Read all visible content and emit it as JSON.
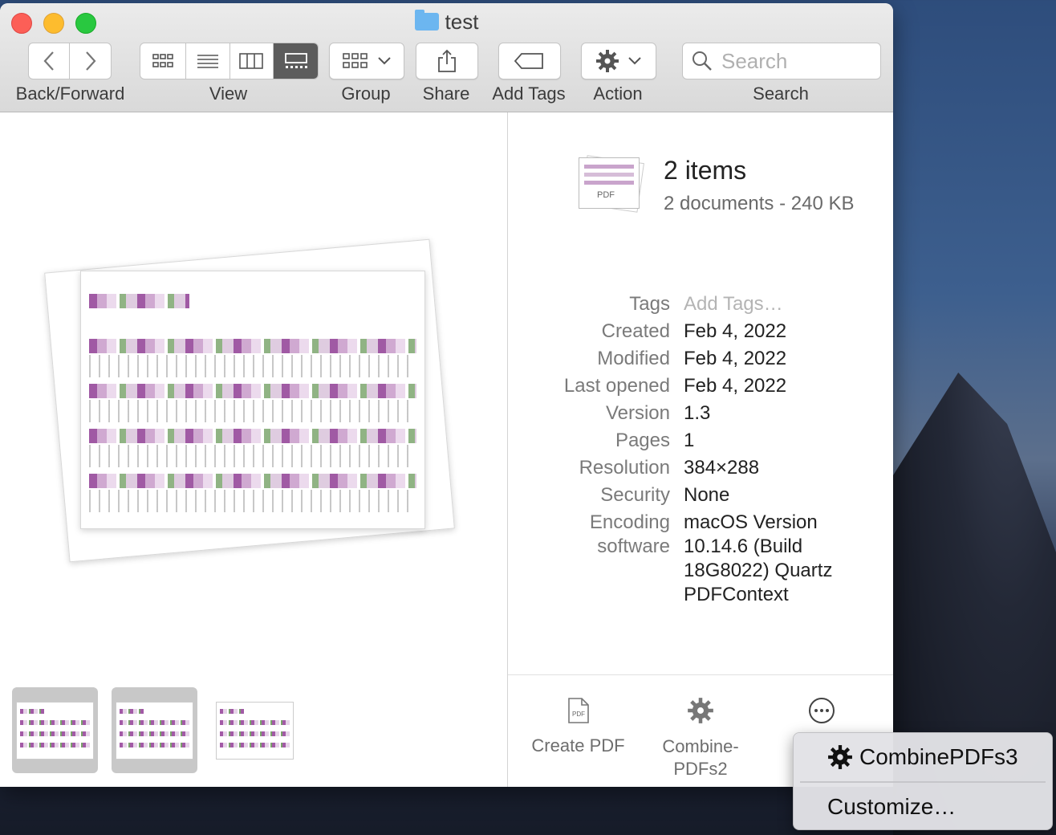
{
  "window": {
    "title": "test"
  },
  "toolbar": {
    "back_forward_label": "Back/Forward",
    "view_label": "View",
    "group_label": "Group",
    "share_label": "Share",
    "add_tags_label": "Add Tags",
    "action_label": "Action",
    "search_label": "Search",
    "search_placeholder": "Search"
  },
  "info": {
    "title": "2 items",
    "subtitle": "2 documents - 240 KB",
    "fields": [
      {
        "key": "Tags",
        "value": "Add Tags…"
      },
      {
        "key": "Created",
        "value": "Feb 4, 2022"
      },
      {
        "key": "Modified",
        "value": "Feb 4, 2022"
      },
      {
        "key": "Last opened",
        "value": "Feb 4, 2022"
      },
      {
        "key": "Version",
        "value": "1.3"
      },
      {
        "key": "Pages",
        "value": "1"
      },
      {
        "key": "Resolution",
        "value": "384×288"
      },
      {
        "key": "Security",
        "value": "None"
      },
      {
        "key": "Encoding",
        "value": "macOS Version"
      },
      {
        "key": "software",
        "value": "10.14.6 (Build"
      },
      {
        "key": "",
        "value": "18G8022) Quartz"
      },
      {
        "key": "",
        "value": "PDFContext"
      }
    ]
  },
  "quick_actions": {
    "create_pdf": "Create PDF",
    "combine_line1": "Combine-",
    "combine_line2": "PDFs2"
  },
  "popup_menu": {
    "item1": "CombinePDFs3",
    "item2": "Customize…"
  },
  "icons": {
    "pdf_badge": "PDF"
  }
}
